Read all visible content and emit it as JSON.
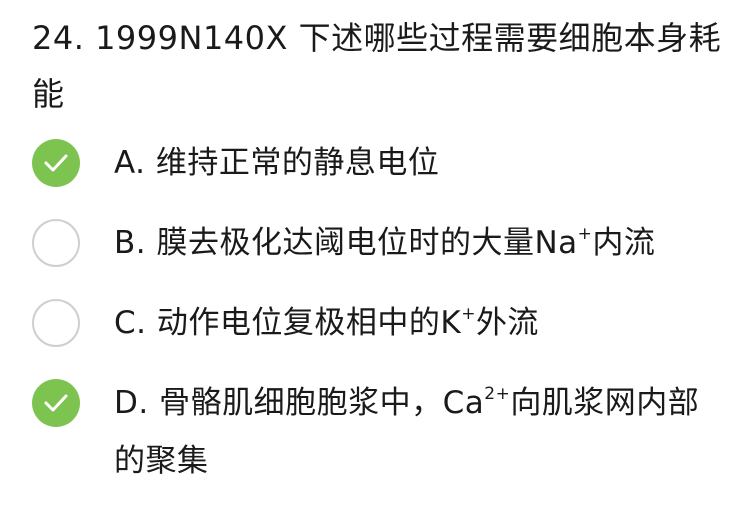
{
  "question": {
    "number": "24.",
    "text": "1999N140X 下述哪些过程需要细胞本身耗能"
  },
  "options": [
    {
      "label": "A.",
      "text": "维持正常的静息电位",
      "checked": true
    },
    {
      "label": "B.",
      "text_before": "膜去极化达阈电位时的大量Na",
      "superscript": "+",
      "text_after": "内流",
      "checked": false
    },
    {
      "label": "C.",
      "text_before": "动作电位复极相中的K",
      "superscript": "+",
      "text_after": "外流",
      "checked": false
    },
    {
      "label": "D.",
      "text_before": "骨骼肌细胞胞浆中，Ca",
      "superscript": "2+",
      "text_after": "向肌浆网内部的聚集",
      "checked": true
    }
  ],
  "colors": {
    "checked": "#7cc44f",
    "unchecked_border": "#cfcfcf",
    "text": "#1a1a1a"
  },
  "icons": {
    "checked": "check-icon",
    "unchecked": "empty-circle-icon"
  }
}
